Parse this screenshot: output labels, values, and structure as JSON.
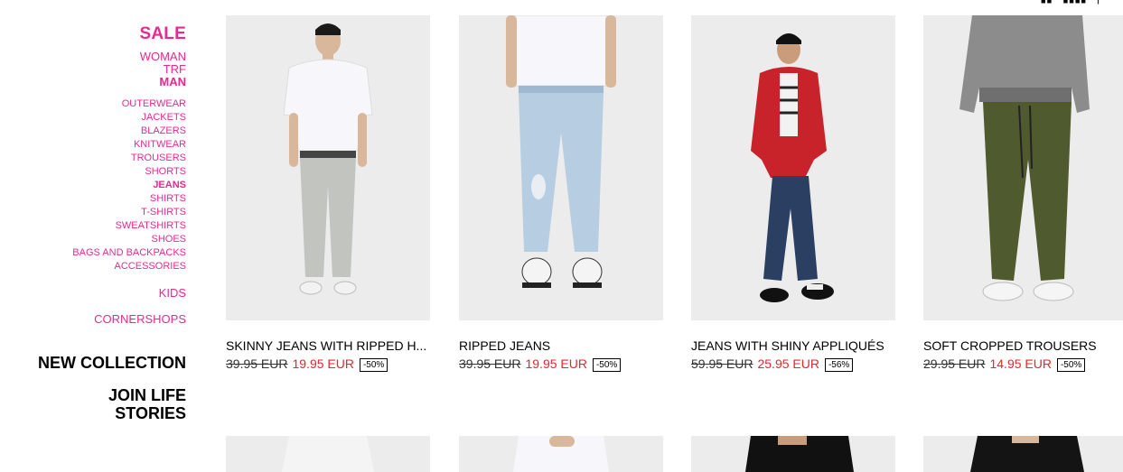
{
  "sidebar": {
    "sale": "SALE",
    "top_categories": [
      {
        "label": "WOMAN",
        "active": false
      },
      {
        "label": "TRF",
        "active": false
      },
      {
        "label": "MAN",
        "active": true
      }
    ],
    "sub_categories": [
      {
        "label": "OUTERWEAR",
        "active": false
      },
      {
        "label": "JACKETS",
        "active": false
      },
      {
        "label": "BLAZERS",
        "active": false
      },
      {
        "label": "KNITWEAR",
        "active": false
      },
      {
        "label": "TROUSERS",
        "active": false
      },
      {
        "label": "SHORTS",
        "active": false
      },
      {
        "label": "JEANS",
        "active": true
      },
      {
        "label": "SHIRTS",
        "active": false
      },
      {
        "label": "T-SHIRTS",
        "active": false
      },
      {
        "label": "SWEATSHIRTS",
        "active": false
      },
      {
        "label": "SHOES",
        "active": false
      },
      {
        "label": "BAGS AND BACKPACKS",
        "active": false
      },
      {
        "label": "ACCESSORIES",
        "active": false
      }
    ],
    "kids": "KIDS",
    "cornershops": "CORNERSHOPS",
    "new_collection": "NEW COLLECTION",
    "join_line1": "JOIN LIFE",
    "join_line2": "STORIES"
  },
  "colors": {
    "accent": "#e8298f",
    "sale_price": "#e8252b",
    "image_bg": "#ececec"
  },
  "products": [
    {
      "name": "SKINNY JEANS WITH RIPPED H...",
      "old_price": "39.95 EUR",
      "new_price": "19.95 EUR",
      "discount": "-50%"
    },
    {
      "name": "RIPPED JEANS",
      "old_price": "39.95 EUR",
      "new_price": "19.95 EUR",
      "discount": "-50%"
    },
    {
      "name": "JEANS WITH SHINY APPLIQUÉS",
      "old_price": "59.95 EUR",
      "new_price": "25.95 EUR",
      "discount": "-56%"
    },
    {
      "name": "SOFT CROPPED TROUSERS",
      "old_price": "29.95 EUR",
      "new_price": "14.95 EUR",
      "discount": "-50%"
    }
  ]
}
